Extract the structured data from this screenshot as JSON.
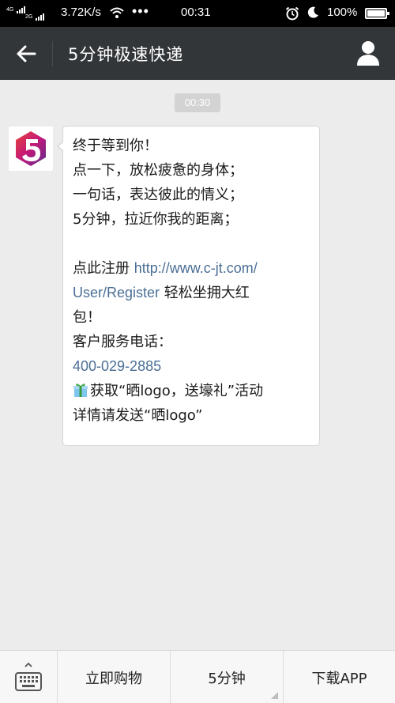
{
  "status_bar": {
    "network_top": "4G",
    "network_bottom": "2G",
    "speed": "3.72K/s",
    "dots": "•••",
    "time": "00:31",
    "battery": "100%"
  },
  "header": {
    "title": "5分钟极速快递",
    "back_icon": "back-arrow-icon",
    "profile_icon": "person-icon"
  },
  "chat": {
    "timestamp": "00:30",
    "message": {
      "line1": "终于等到你！",
      "line2": "点一下，放松疲惫的身体；",
      "line3": "一句话，表达彼此的情义；",
      "line4": "5分钟，拉近你我的距离；",
      "register_prefix": "点此注册 ",
      "register_link_part1": "http://www.c-jt.com/",
      "register_link_part2": "User/Register",
      "register_suffix1": " 轻松坐拥大红",
      "register_suffix2": "包！",
      "service_label": "客户服务电话：",
      "phone": "400-029-2885",
      "promo_line1": "获取“晒logo，送壕礼”活动",
      "promo_line2": "详情请发送“晒logo”"
    }
  },
  "bottom_menu": {
    "keyboard_icon": "keyboard-icon",
    "items": [
      "立即购物",
      "5分钟",
      "下载APP"
    ]
  },
  "colors": {
    "header_bg": "#333639",
    "link": "#4a6f96",
    "chat_bg": "#ececec"
  }
}
